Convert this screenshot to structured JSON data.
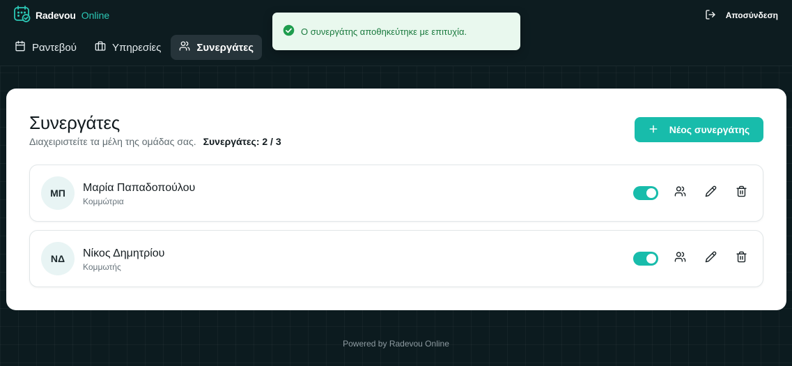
{
  "brand": {
    "name": "Radevou",
    "accent": "Online"
  },
  "header": {
    "logout_label": "Αποσύνδεση"
  },
  "nav": {
    "items": [
      {
        "label": "Ραντεβού",
        "icon": "calendar-icon"
      },
      {
        "label": "Υπηρεσίες",
        "icon": "briefcase-icon"
      },
      {
        "label": "Συνεργάτες",
        "icon": "users-icon",
        "active": true
      }
    ]
  },
  "toast": {
    "message": "Ο συνεργάτης αποθηκεύτηκε με επιτυχία.",
    "icon": "check-circle-icon"
  },
  "page": {
    "title": "Συνεργάτες",
    "subtitle": "Διαχειριστείτε τα μέλη της ομάδας σας.",
    "count_label": "Συνεργάτες: 2 / 3",
    "new_button_label": "Νέος συνεργάτης"
  },
  "partners": [
    {
      "initials": "ΜΠ",
      "name": "Μαρία Παπαδοπούλου",
      "role": "Κομμώτρια",
      "active": true
    },
    {
      "initials": "ΝΔ",
      "name": "Νίκος Δημητρίου",
      "role": "Κομμωτής",
      "active": true
    }
  ],
  "footer": {
    "text": "Powered by Radevou Online"
  },
  "colors": {
    "accent": "#18bcab",
    "brand_accent": "#2cc8b6",
    "background": "#0c1b1f",
    "toast_bg": "#e9f8ee",
    "toast_text": "#1a7a3e"
  }
}
